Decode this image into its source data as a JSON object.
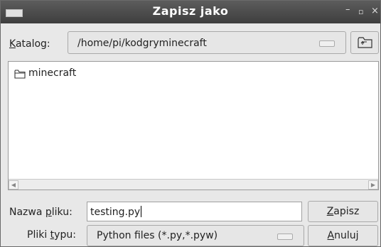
{
  "window": {
    "title": "Zapisz jako",
    "minimize": "–",
    "maximize": "▫",
    "close": "×"
  },
  "directory": {
    "label_accel": "K",
    "label_rest": "atalog:",
    "path": "/home/pi/kodgryminecraft"
  },
  "files": [
    {
      "name": "minecraft",
      "type": "folder"
    }
  ],
  "filename": {
    "label_pre": "Nazwa ",
    "label_accel": "p",
    "label_post": "liku:",
    "value": "testing.py"
  },
  "filetype": {
    "label_pre": "Pliki ",
    "label_accel": "t",
    "label_post": "ypu:",
    "value": "Python files (*.py,*.pyw)"
  },
  "buttons": {
    "save_accel": "Z",
    "save_rest": "apisz",
    "cancel_accel": "A",
    "cancel_rest": "nuluj"
  }
}
